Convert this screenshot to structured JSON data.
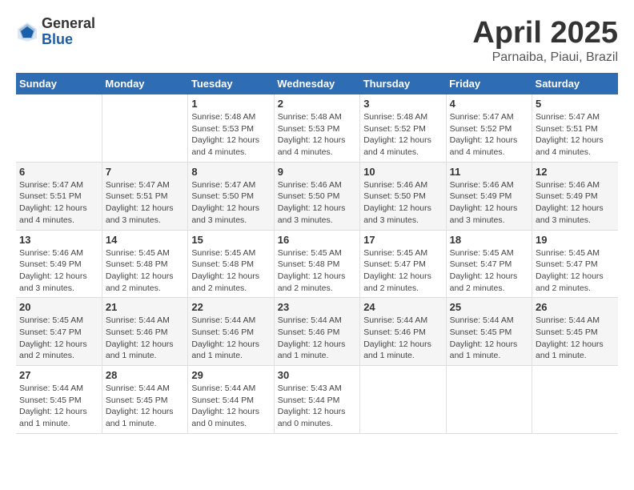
{
  "logo": {
    "general": "General",
    "blue": "Blue"
  },
  "header": {
    "month": "April 2025",
    "location": "Parnaiba, Piaui, Brazil"
  },
  "weekdays": [
    "Sunday",
    "Monday",
    "Tuesday",
    "Wednesday",
    "Thursday",
    "Friday",
    "Saturday"
  ],
  "weeks": [
    [
      {
        "day": "",
        "sunrise": "",
        "sunset": "",
        "daylight": ""
      },
      {
        "day": "",
        "sunrise": "",
        "sunset": "",
        "daylight": ""
      },
      {
        "day": "1",
        "sunrise": "Sunrise: 5:48 AM",
        "sunset": "Sunset: 5:53 PM",
        "daylight": "Daylight: 12 hours and 4 minutes."
      },
      {
        "day": "2",
        "sunrise": "Sunrise: 5:48 AM",
        "sunset": "Sunset: 5:53 PM",
        "daylight": "Daylight: 12 hours and 4 minutes."
      },
      {
        "day": "3",
        "sunrise": "Sunrise: 5:48 AM",
        "sunset": "Sunset: 5:52 PM",
        "daylight": "Daylight: 12 hours and 4 minutes."
      },
      {
        "day": "4",
        "sunrise": "Sunrise: 5:47 AM",
        "sunset": "Sunset: 5:52 PM",
        "daylight": "Daylight: 12 hours and 4 minutes."
      },
      {
        "day": "5",
        "sunrise": "Sunrise: 5:47 AM",
        "sunset": "Sunset: 5:51 PM",
        "daylight": "Daylight: 12 hours and 4 minutes."
      }
    ],
    [
      {
        "day": "6",
        "sunrise": "Sunrise: 5:47 AM",
        "sunset": "Sunset: 5:51 PM",
        "daylight": "Daylight: 12 hours and 4 minutes."
      },
      {
        "day": "7",
        "sunrise": "Sunrise: 5:47 AM",
        "sunset": "Sunset: 5:51 PM",
        "daylight": "Daylight: 12 hours and 3 minutes."
      },
      {
        "day": "8",
        "sunrise": "Sunrise: 5:47 AM",
        "sunset": "Sunset: 5:50 PM",
        "daylight": "Daylight: 12 hours and 3 minutes."
      },
      {
        "day": "9",
        "sunrise": "Sunrise: 5:46 AM",
        "sunset": "Sunset: 5:50 PM",
        "daylight": "Daylight: 12 hours and 3 minutes."
      },
      {
        "day": "10",
        "sunrise": "Sunrise: 5:46 AM",
        "sunset": "Sunset: 5:50 PM",
        "daylight": "Daylight: 12 hours and 3 minutes."
      },
      {
        "day": "11",
        "sunrise": "Sunrise: 5:46 AM",
        "sunset": "Sunset: 5:49 PM",
        "daylight": "Daylight: 12 hours and 3 minutes."
      },
      {
        "day": "12",
        "sunrise": "Sunrise: 5:46 AM",
        "sunset": "Sunset: 5:49 PM",
        "daylight": "Daylight: 12 hours and 3 minutes."
      }
    ],
    [
      {
        "day": "13",
        "sunrise": "Sunrise: 5:46 AM",
        "sunset": "Sunset: 5:49 PM",
        "daylight": "Daylight: 12 hours and 3 minutes."
      },
      {
        "day": "14",
        "sunrise": "Sunrise: 5:45 AM",
        "sunset": "Sunset: 5:48 PM",
        "daylight": "Daylight: 12 hours and 2 minutes."
      },
      {
        "day": "15",
        "sunrise": "Sunrise: 5:45 AM",
        "sunset": "Sunset: 5:48 PM",
        "daylight": "Daylight: 12 hours and 2 minutes."
      },
      {
        "day": "16",
        "sunrise": "Sunrise: 5:45 AM",
        "sunset": "Sunset: 5:48 PM",
        "daylight": "Daylight: 12 hours and 2 minutes."
      },
      {
        "day": "17",
        "sunrise": "Sunrise: 5:45 AM",
        "sunset": "Sunset: 5:47 PM",
        "daylight": "Daylight: 12 hours and 2 minutes."
      },
      {
        "day": "18",
        "sunrise": "Sunrise: 5:45 AM",
        "sunset": "Sunset: 5:47 PM",
        "daylight": "Daylight: 12 hours and 2 minutes."
      },
      {
        "day": "19",
        "sunrise": "Sunrise: 5:45 AM",
        "sunset": "Sunset: 5:47 PM",
        "daylight": "Daylight: 12 hours and 2 minutes."
      }
    ],
    [
      {
        "day": "20",
        "sunrise": "Sunrise: 5:45 AM",
        "sunset": "Sunset: 5:47 PM",
        "daylight": "Daylight: 12 hours and 2 minutes."
      },
      {
        "day": "21",
        "sunrise": "Sunrise: 5:44 AM",
        "sunset": "Sunset: 5:46 PM",
        "daylight": "Daylight: 12 hours and 1 minute."
      },
      {
        "day": "22",
        "sunrise": "Sunrise: 5:44 AM",
        "sunset": "Sunset: 5:46 PM",
        "daylight": "Daylight: 12 hours and 1 minute."
      },
      {
        "day": "23",
        "sunrise": "Sunrise: 5:44 AM",
        "sunset": "Sunset: 5:46 PM",
        "daylight": "Daylight: 12 hours and 1 minute."
      },
      {
        "day": "24",
        "sunrise": "Sunrise: 5:44 AM",
        "sunset": "Sunset: 5:46 PM",
        "daylight": "Daylight: 12 hours and 1 minute."
      },
      {
        "day": "25",
        "sunrise": "Sunrise: 5:44 AM",
        "sunset": "Sunset: 5:45 PM",
        "daylight": "Daylight: 12 hours and 1 minute."
      },
      {
        "day": "26",
        "sunrise": "Sunrise: 5:44 AM",
        "sunset": "Sunset: 5:45 PM",
        "daylight": "Daylight: 12 hours and 1 minute."
      }
    ],
    [
      {
        "day": "27",
        "sunrise": "Sunrise: 5:44 AM",
        "sunset": "Sunset: 5:45 PM",
        "daylight": "Daylight: 12 hours and 1 minute."
      },
      {
        "day": "28",
        "sunrise": "Sunrise: 5:44 AM",
        "sunset": "Sunset: 5:45 PM",
        "daylight": "Daylight: 12 hours and 1 minute."
      },
      {
        "day": "29",
        "sunrise": "Sunrise: 5:44 AM",
        "sunset": "Sunset: 5:44 PM",
        "daylight": "Daylight: 12 hours and 0 minutes."
      },
      {
        "day": "30",
        "sunrise": "Sunrise: 5:43 AM",
        "sunset": "Sunset: 5:44 PM",
        "daylight": "Daylight: 12 hours and 0 minutes."
      },
      {
        "day": "",
        "sunrise": "",
        "sunset": "",
        "daylight": ""
      },
      {
        "day": "",
        "sunrise": "",
        "sunset": "",
        "daylight": ""
      },
      {
        "day": "",
        "sunrise": "",
        "sunset": "",
        "daylight": ""
      }
    ]
  ]
}
